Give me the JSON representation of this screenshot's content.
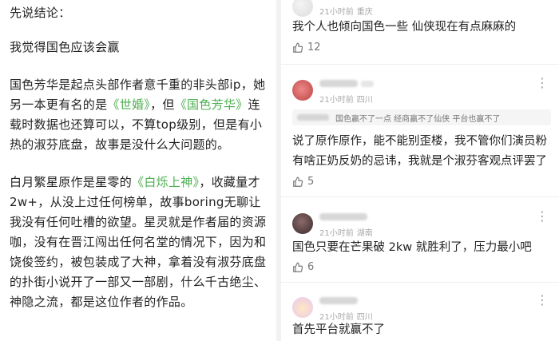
{
  "article": {
    "p1": "先说结论：",
    "p2": "我觉得国色应该会赢",
    "p3_a": "国色芳华是起点头部作者意千重的非头部ip，她另一本更有名的是",
    "p3_hl1": "《世婚》",
    "p3_b": "，但",
    "p3_hl2": "《国色芳华》",
    "p3_c": "连载时数据也还算可以，不算top级别，但是有小热的淑芬底盘，故事是没什么大问题的。",
    "p4_a": "白月繁星原作是星零的",
    "p4_hl": "《白烁上神》",
    "p4_b": "，收藏量才2w+，从没上过任何榜单，故事boring无聊让我没有任何吐槽的欲望。星灵就是作者届的资源咖，没有在晋江闯出任何名堂的情况下，因为和饶俊签约，被包装成了大神，拿着没有淑芬底盘的扑街小说开了一部又一部剧，什么千古绝尘、神隐之流，都是这位作者的作品。"
  },
  "comments": [
    {
      "time": "21小时前",
      "location": "重庆",
      "text": "我个人也倾向国色一些 仙侠现在有点麻麻的",
      "likes": "12"
    },
    {
      "time": "21小时前",
      "location": "四川",
      "quote": "国色赢不了一点 经商赢不了仙侠 平台也赢不了",
      "text": "说了原作原作，能不能别歪楼，我不管你们演员粉有啥正奶反奶的忌讳，我就是个淑芬客观点评罢了",
      "likes": "5"
    },
    {
      "time": "21小时前",
      "location": "湖南",
      "text": "国色只要在芒果破 2kw 就胜利了，压力最小吧",
      "likes": "6"
    },
    {
      "time": "21小时前",
      "location": "四川",
      "text": "首先平台就赢不了"
    }
  ],
  "more_icon": "⋮",
  "colors": {
    "highlight": "#4caf50",
    "divider": "#f2f2f2",
    "meta": "#a8a8a8"
  }
}
